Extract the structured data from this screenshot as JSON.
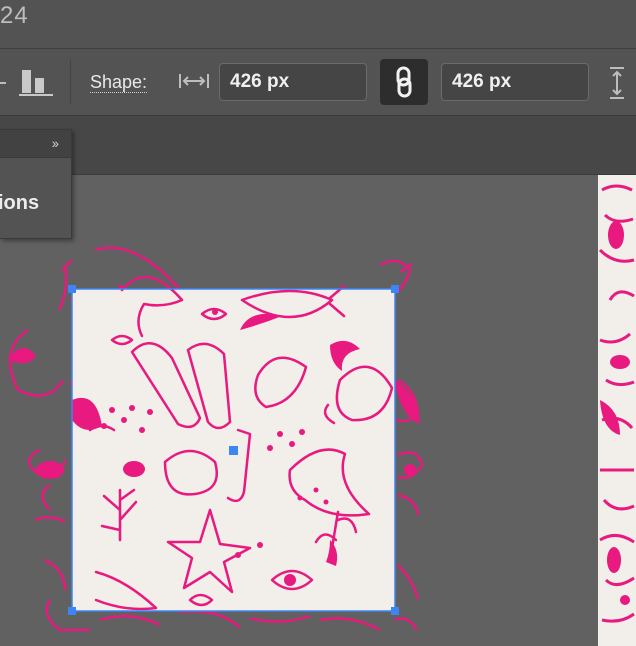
{
  "titlebar": {
    "title_fragment": "24"
  },
  "options_bar": {
    "shape_label": "Shape:",
    "width_value": "426 px",
    "height_value": "426 px"
  },
  "panel": {
    "text_fragment": "ions"
  },
  "colors": {
    "pattern_ink": "#e8197f",
    "pattern_bg": "#f2eeea",
    "selection": "#3d85f5"
  },
  "icons": [
    "align-bottom-icon",
    "width-arrows-icon",
    "link-icon",
    "height-arrows-icon",
    "collapse-chevrons-icon"
  ]
}
